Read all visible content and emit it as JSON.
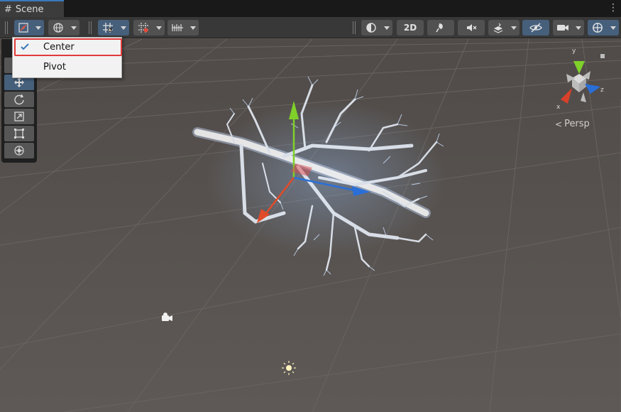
{
  "tab": {
    "title": "Scene",
    "icon": "grid-hash-icon",
    "menu_icon": "kebab-menu-icon"
  },
  "toolbar": {
    "left_buttons": [
      "transform-pivot-center-icon",
      "global-local-icon",
      "grid-snap-icon",
      "increment-snap-icon",
      "grid-visibility-icon"
    ],
    "right_buttons": [
      "draw-mode-icon",
      "2d-toggle",
      "lighting-icon",
      "audio-mute-icon",
      "effects-icon",
      "hidden-objects-icon",
      "camera-icon",
      "gizmos-icon"
    ],
    "mode_2d_label": "2D"
  },
  "dropdown": {
    "items": [
      {
        "label": "Center",
        "checked": true
      },
      {
        "label": "Pivot",
        "checked": false
      }
    ],
    "highlight_color": "#e23b3b"
  },
  "tools": [
    "view-hand-icon",
    "move-icon",
    "rotate-icon",
    "scale-icon",
    "rect-icon",
    "transform-icon"
  ],
  "orientation_gizmo": {
    "projection_label": "Persp",
    "axes": [
      "y",
      "z",
      "x"
    ]
  },
  "colors": {
    "accent": "#3a79bb",
    "active_button": "#46607c",
    "viewport_bg": "#5a5552",
    "axis_x": "#d8402a",
    "axis_y": "#7fd12a",
    "axis_z": "#2a6fd8"
  }
}
